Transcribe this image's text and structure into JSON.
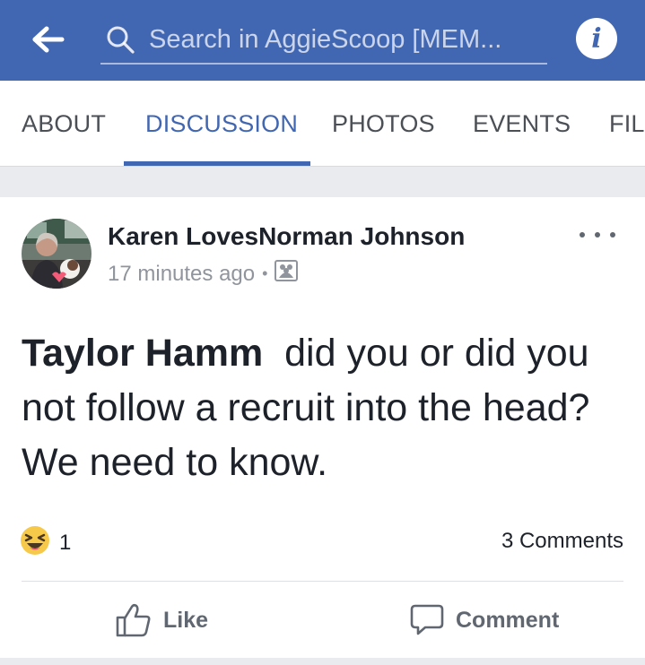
{
  "header": {
    "search_text": "Search in AggieScoop [MEM...",
    "info_label": "i",
    "colors": {
      "bar": "#4267b2",
      "icon": "#ffffff"
    },
    "icons": {
      "back": "back-arrow-icon",
      "search": "search-icon",
      "info": "info-icon"
    }
  },
  "tabs": [
    {
      "label": "ABOUT",
      "active": false
    },
    {
      "label": "DISCUSSION",
      "active": true
    },
    {
      "label": "PHOTOS",
      "active": false
    },
    {
      "label": "EVENTS",
      "active": false
    },
    {
      "label": "FIL",
      "active": false
    }
  ],
  "post": {
    "author": "Karen LovesNorman Johnson",
    "timestamp": "17 minutes ago",
    "separator": "•",
    "audience_icon": "group-members-icon",
    "mention": "Taylor Hamm",
    "text": "  did you or did you not follow a recruit into the head?  We need to know.",
    "reaction_emoji": "laughing-face-icon",
    "reaction_count": "1",
    "comments_count": "3 Comments",
    "actions": {
      "like": "Like",
      "comment": "Comment"
    },
    "more_icon": "more-options-icon"
  }
}
